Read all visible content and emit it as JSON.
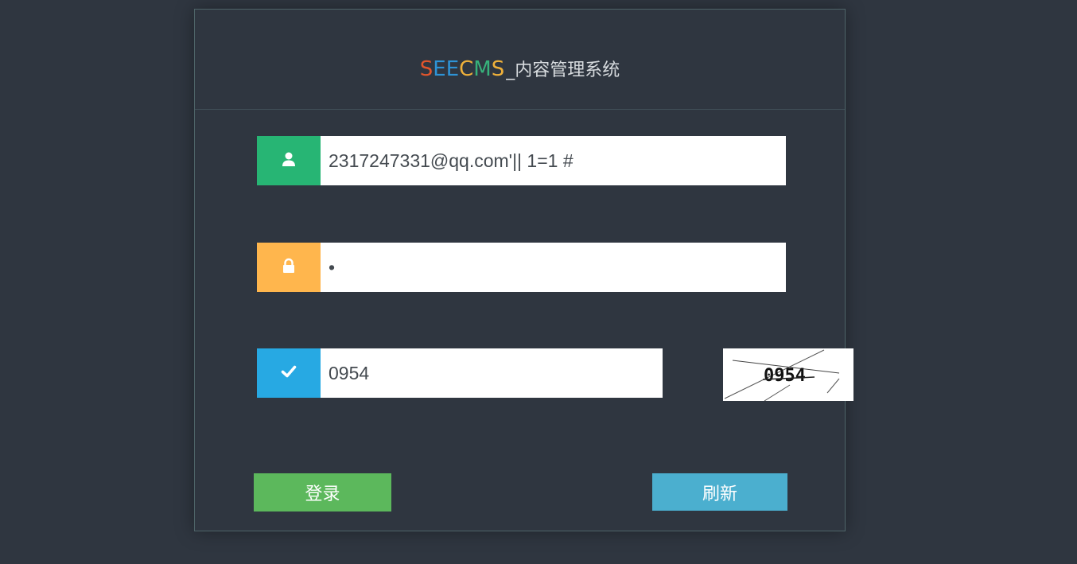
{
  "header": {
    "logo_letters": [
      {
        "char": "S",
        "color": "#e2552c"
      },
      {
        "char": "E",
        "color": "#2e93d6"
      },
      {
        "char": "E",
        "color": "#2e93d6"
      },
      {
        "char": "C",
        "color": "#f0b13a"
      },
      {
        "char": "M",
        "color": "#37b27b"
      },
      {
        "char": "S",
        "color": "#f0b13a"
      }
    ],
    "logo_suffix": "_内容管理系统"
  },
  "form": {
    "username": {
      "value": "2317247331@qq.com'|| 1=1 #",
      "icon": "user-icon",
      "icon_color": "#27b574"
    },
    "password": {
      "value": "•",
      "icon": "lock-icon",
      "icon_color": "#ffb64d"
    },
    "captcha": {
      "value": "0954",
      "image_text": "0954",
      "icon": "check-icon",
      "icon_color": "#27a9e3"
    }
  },
  "buttons": {
    "login_label": "登录",
    "login_color": "#5cb85c",
    "refresh_label": "刷新",
    "refresh_color": "#4bafcf"
  }
}
